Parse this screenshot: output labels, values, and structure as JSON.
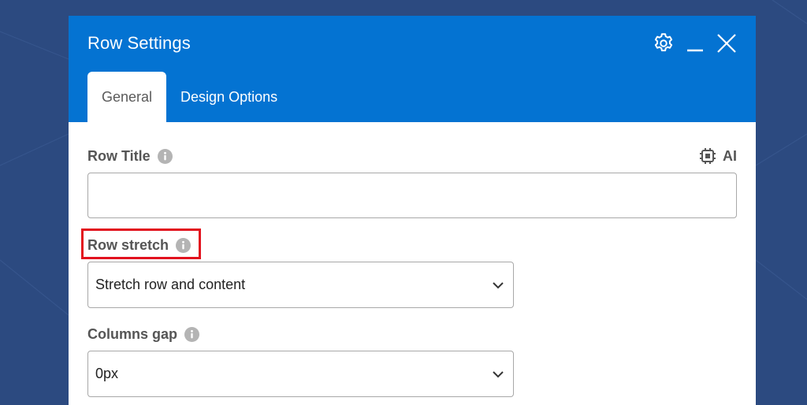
{
  "modal": {
    "title": "Row Settings",
    "header_icons": [
      "gear-icon",
      "minimize-icon",
      "close-icon"
    ],
    "tabs": [
      {
        "label": "General",
        "active": true
      },
      {
        "label": "Design Options",
        "active": false
      }
    ]
  },
  "fields": {
    "row_title": {
      "label": "Row Title",
      "value": "",
      "placeholder": "",
      "ai_label": "AI"
    },
    "row_stretch": {
      "label": "Row stretch",
      "selected": "Stretch row and content",
      "highlighted": true
    },
    "columns_gap": {
      "label": "Columns gap",
      "selected": "0px"
    }
  },
  "colors": {
    "background": "#2c4a80",
    "header": "#0473d2",
    "highlight": "#e2121e",
    "label": "#555555",
    "info_icon": "#b4b4b4"
  }
}
